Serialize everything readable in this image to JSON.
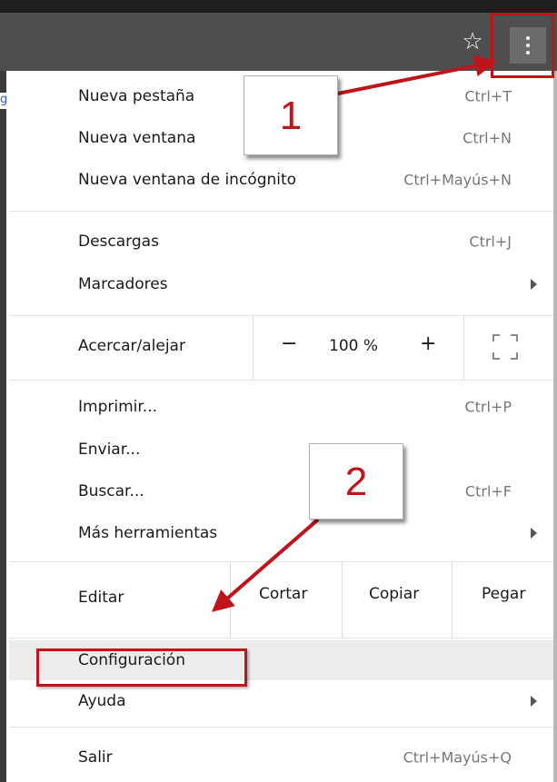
{
  "toolbar": {
    "bookmark_icon": "star-icon",
    "menu_icon": "kebab-menu-icon",
    "left_stub": "g"
  },
  "menu": {
    "items": [
      {
        "label": "Nueva pestaña",
        "shortcut": "Ctrl+T"
      },
      {
        "label": "Nueva ventana",
        "shortcut": "Ctrl+N"
      },
      {
        "label": "Nueva ventana de incógnito",
        "shortcut": "Ctrl+Mayús+N"
      },
      {
        "label": "Descargas",
        "shortcut": "Ctrl+J"
      },
      {
        "label": "Marcadores",
        "shortcut": ""
      },
      {
        "label": "Imprimir...",
        "shortcut": "Ctrl+P"
      },
      {
        "label": "Enviar...",
        "shortcut": ""
      },
      {
        "label": "Buscar...",
        "shortcut": "Ctrl+F"
      },
      {
        "label": "Más herramientas",
        "shortcut": ""
      },
      {
        "label": "Configuración",
        "shortcut": ""
      },
      {
        "label": "Ayuda",
        "shortcut": ""
      },
      {
        "label": "Salir",
        "shortcut": "Ctrl+Mayús+Q"
      }
    ],
    "zoom": {
      "label": "Acercar/alejar",
      "minus": "−",
      "value": "100 %",
      "plus": "+"
    },
    "edit": {
      "label": "Editar",
      "cut": "Cortar",
      "copy": "Copiar",
      "paste": "Pegar"
    }
  },
  "annotations": {
    "step1": "1",
    "step2": "2",
    "color": "#c0141b"
  }
}
